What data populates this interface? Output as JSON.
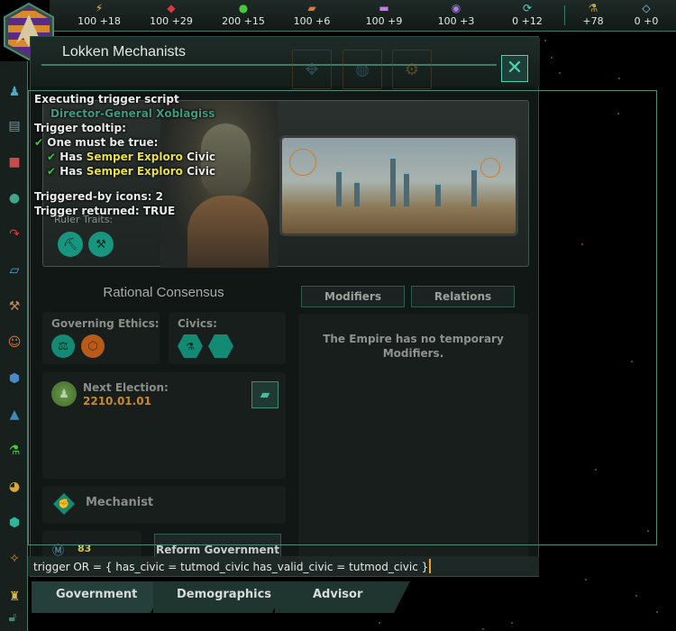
{
  "topbar": {
    "resources": [
      {
        "name": "energy",
        "icon": "⚡",
        "color": "#e6b84a",
        "value": "100 +18"
      },
      {
        "name": "minerals",
        "icon": "◆",
        "color": "#d83a3a",
        "value": "100 +29"
      },
      {
        "name": "food",
        "icon": "●",
        "color": "#4ac83a",
        "value": "200 +15"
      },
      {
        "name": "consumer-goods",
        "icon": "▰",
        "color": "#d87a3a",
        "value": "100 +6"
      },
      {
        "name": "alloys",
        "icon": "▬",
        "color": "#c87ae6",
        "value": "100 +9"
      },
      {
        "name": "influence",
        "icon": "◉",
        "color": "#a87ae6",
        "value": "100 +3"
      },
      {
        "name": "unity",
        "icon": "⟳",
        "color": "#4ad8c8",
        "value": "0 +12"
      },
      {
        "name": "research",
        "icon": "⚗",
        "color": "#c8a84a",
        "value": "+78"
      },
      {
        "name": "naval-capacity",
        "icon": "◇",
        "color": "#8ad8e6",
        "value": "0 +0"
      }
    ]
  },
  "window": {
    "title": "Lokken Mechanists",
    "close_icon": "✕",
    "header_buttons": [
      "search-empire",
      "search-planet",
      "search-settings"
    ]
  },
  "leader": {
    "name": "Director-General Xoblagiss",
    "traits_label": "Ruler Traits:",
    "traits": [
      "mining-cart",
      "pickaxe"
    ]
  },
  "government": {
    "title": "Rational Consensus",
    "ethics_label": "Governing Ethics:",
    "civics_label": "Civics:",
    "election_label": "Next Election:",
    "election_date": "2210.01.01",
    "authority_label": "Mechanist",
    "unity_value": "83",
    "reform_button": "Reform Government"
  },
  "modifiers": {
    "tabs": [
      "Modifiers",
      "Relations"
    ],
    "empty_text": "The Empire has no temporary Modifiers."
  },
  "debug": {
    "line1": "Executing trigger script",
    "line2": "Trigger tooltip:",
    "line3": "One must be true:",
    "has": "Has",
    "civic_name": "Semper Exploro",
    "civic_suffix": "Civic",
    "line6": "Triggered-by icons: 2",
    "line7": "Trigger returned: TRUE",
    "check": "✔"
  },
  "console": {
    "value": "trigger OR = { has_civic = tutmod_civic has_valid_civic = tutmod_civic }"
  },
  "bottom_tabs": [
    "Government",
    "Demographics",
    "Advisor"
  ],
  "colors": {
    "accent": "#3e7a68",
    "teal": "#138a74",
    "highlight": "#e8e040",
    "date": "#c88a2a"
  }
}
